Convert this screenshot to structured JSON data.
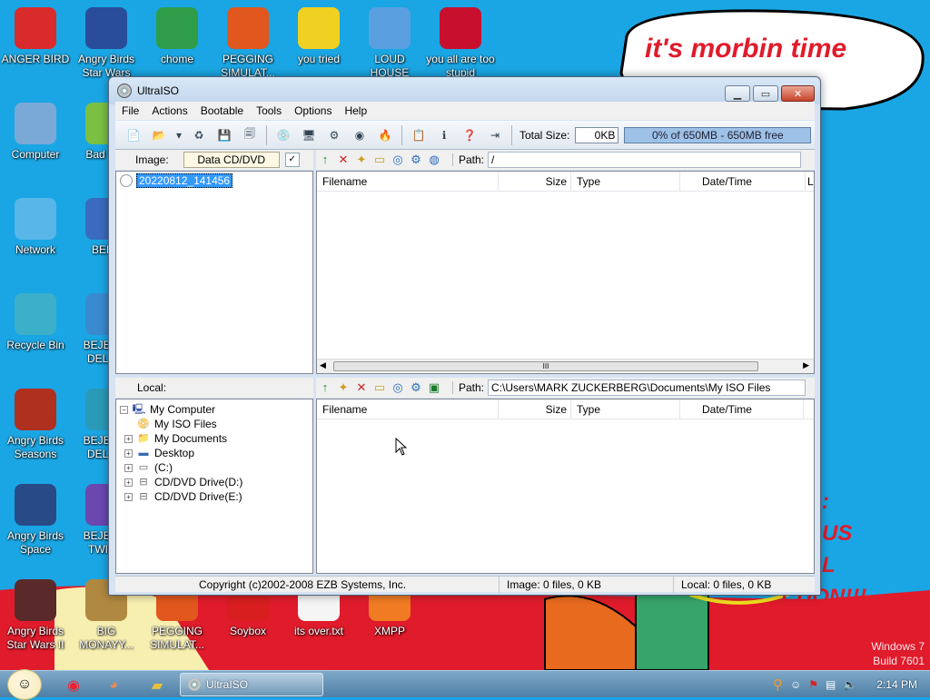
{
  "desktop": {
    "meme_text": "it's morbin time",
    "wallpaper_colors": {
      "sky": "#1aa6e4",
      "bubble": "#ffffff",
      "text_red": "#e01b2b",
      "ground": "#e01b2b"
    },
    "icons": [
      {
        "label": "ANGER BIRD",
        "icon": "angry-bird-icon",
        "color": "#d92b2b"
      },
      {
        "label": "Angry Birds Star Wars",
        "icon": "angry-birds-star-wars-icon",
        "color": "#2a4d9b"
      },
      {
        "label": "chome",
        "icon": "chrome-icon",
        "color": "#2e9c48"
      },
      {
        "label": "PEGGING SIMULAT...",
        "icon": "pegging-icon",
        "color": "#e2571d"
      },
      {
        "label": "you tried",
        "icon": "star-icon",
        "color": "#f0d020"
      },
      {
        "label": "LOUD HOUSE",
        "icon": "loud-house-icon",
        "color": "#5aa0e0"
      },
      {
        "label": "you all are too stupid",
        "icon": "dev-cpp-icon",
        "color": "#c8102e"
      },
      {
        "label": "Computer",
        "icon": "computer-icon",
        "color": "#7aa9d8"
      },
      {
        "label": "Bad Pi...",
        "icon": "bad-piggies-icon",
        "color": "#7bc043"
      },
      {
        "label": "Network",
        "icon": "network-icon",
        "color": "#58b6e8"
      },
      {
        "label": "BEEP",
        "icon": "beep-icon",
        "color": "#3a6bc0"
      },
      {
        "label": "Recycle Bin",
        "icon": "recycle-bin-icon",
        "color": "#3bb0c8"
      },
      {
        "label": "BEJEW... DELU...",
        "icon": "bejeweled-icon",
        "color": "#3a8ad0"
      },
      {
        "label": "Angry Birds Seasons",
        "icon": "angry-birds-seasons-icon",
        "color": "#b03020"
      },
      {
        "label": "BEJEW... DELU...",
        "icon": "bejeweled-2-icon",
        "color": "#2a9ab8"
      },
      {
        "label": "Angry Birds Space",
        "icon": "angry-birds-space-icon",
        "color": "#284b88"
      },
      {
        "label": "BEJEW... TWIS...",
        "icon": "bejeweled-twist-icon",
        "color": "#6a48b0"
      },
      {
        "label": "Angry Birds Star Wars II",
        "icon": "angry-birds-star-wars-2-icon",
        "color": "#5a2a2a"
      },
      {
        "label": "BIG MONAYY...",
        "icon": "money-bag-icon",
        "color": "#b08840"
      },
      {
        "label": "PEGGING SIMULAT...",
        "icon": "pegging-2-icon",
        "color": "#e2571d"
      },
      {
        "label": "Soybox",
        "icon": "soybox-icon",
        "color": "#d81e1e"
      },
      {
        "label": "its over.txt",
        "icon": "text-file-icon",
        "color": "#f5f5f5"
      },
      {
        "label": "XMPP",
        "icon": "xampp-icon",
        "color": "#f07b22"
      }
    ]
  },
  "window": {
    "title": "UltraISO",
    "menu": [
      "File",
      "Actions",
      "Bootable",
      "Tools",
      "Options",
      "Help"
    ],
    "toolbar": {
      "buttons": [
        "new-icon",
        "open-icon",
        "open-dropdown-icon",
        "extract-icon",
        "save-icon",
        "save-as-icon",
        "burn-icon",
        "mount-icon",
        "compress-icon",
        "virtual-drive-icon",
        "tools-icon",
        "properties-icon",
        "info-icon",
        "help-icon",
        "exit-icon"
      ],
      "total_size_label": "Total Size:",
      "total_size_value": "0KB",
      "capacity_text": "0% of 650MB - 650MB free"
    },
    "image_panel": {
      "label": "Image:",
      "type_value": "Data CD/DVD",
      "tree_root": "20220812_141456",
      "path_label": "Path:",
      "path_value": "/",
      "columns": [
        "Filename",
        "Size",
        "Type",
        "Date/Time",
        "L"
      ],
      "scroll_grip": "III"
    },
    "local_panel": {
      "label": "Local:",
      "path_label": "Path:",
      "path_value": "C:\\Users\\MARK ZUCKERBERG\\Documents\\My ISO Files",
      "columns": [
        "Filename",
        "Size",
        "Type",
        "Date/Time"
      ],
      "tree": [
        {
          "label": "My Computer",
          "icon": "my-computer-icon"
        },
        {
          "label": "My ISO Files",
          "icon": "iso-folder-icon"
        },
        {
          "label": "My Documents",
          "icon": "documents-icon"
        },
        {
          "label": "Desktop",
          "icon": "desktop-icon"
        },
        {
          "label": "(C:)",
          "icon": "hard-drive-icon"
        },
        {
          "label": "CD/DVD Drive(D:)",
          "icon": "cd-drive-icon"
        },
        {
          "label": "CD/DVD Drive(E:)",
          "icon": "cd-drive-icon"
        }
      ]
    },
    "status": {
      "copyright": "Copyright (c)2002-2008 EZB Systems, Inc.",
      "image_info": "Image: 0 files, 0 KB",
      "local_info": "Local: 0 files, 0 KB"
    }
  },
  "taskbar": {
    "pinned": [
      "chrome-icon",
      "firefox-icon",
      "explorer-icon"
    ],
    "active_task": "UltraISO",
    "clock": "2:14 PM",
    "tray": [
      "search-icon",
      "smiley-icon",
      "action-center-icon",
      "network-icon",
      "volume-icon"
    ]
  },
  "os": {
    "line1": "Windows 7",
    "line2": "Build 7601"
  }
}
